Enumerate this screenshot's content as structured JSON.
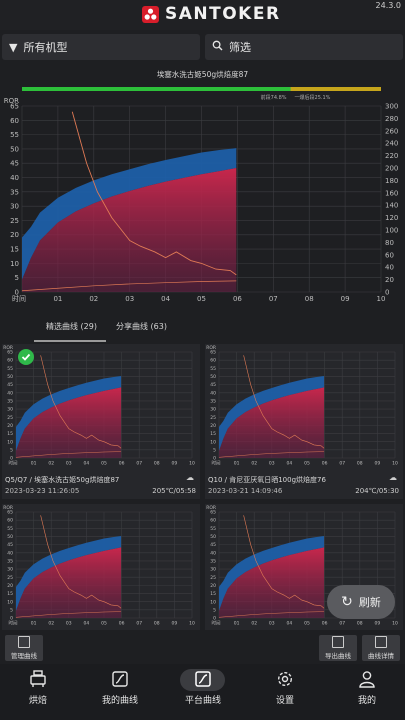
{
  "app": {
    "brand": "SANTOKER",
    "version": "24.3.0"
  },
  "filters": {
    "machine_label": "所有机型",
    "filter_label": "筛选"
  },
  "main_chart": {
    "title": "埃塞水洗古姬50g烘焙度87",
    "left_axis_label": "ROR",
    "x_axis_label": "时间",
    "progress_left_text": "前段74.8%",
    "progress_right_text": "一爆后段25.1%",
    "progress_fraction": 0.748,
    "colors": {
      "progress_green": "#2dbf3a",
      "progress_yellow": "#c6a51c",
      "fill_blue": "#1e5fa8",
      "fill_red": "#c8274c",
      "ror_line": "#e07a55"
    }
  },
  "tabs": {
    "selected": "精选曲线 (29)",
    "shared": "分享曲线 (63)"
  },
  "cards": [
    {
      "title": "Q5/Q7 / 埃塞水洗古姬50g烘焙度87",
      "date": "2023-03-23 11:26:05",
      "meta": "205℃/05:58",
      "selected": true
    },
    {
      "title": "Q10 / 肯尼亚厌氧日晒100g烘焙度76",
      "date": "2023-03-21 14:09:46",
      "meta": "204℃/05:30",
      "selected": false
    },
    {
      "title": "",
      "date": "",
      "meta": "",
      "selected": false
    },
    {
      "title": "",
      "date": "",
      "meta": "",
      "selected": false
    }
  ],
  "refresh_label": "刷新",
  "tools": {
    "manage": "管理曲线",
    "export": "导出曲线",
    "detail": "曲线详情"
  },
  "nav": {
    "roast": "烘焙",
    "my_curves": "我的曲线",
    "platform": "平台曲线",
    "settings": "设置",
    "mine": "我的"
  },
  "chart_data": {
    "type": "area",
    "title": "埃塞水洗古姬50g烘焙度87",
    "xlabel": "时间",
    "ylabel": "ROR",
    "x_ticks": [
      "01",
      "02",
      "03",
      "04",
      "05",
      "06",
      "07",
      "08",
      "09",
      "10"
    ],
    "y_left_ticks": [
      0,
      5,
      10,
      15,
      20,
      25,
      30,
      35,
      40,
      45,
      50,
      55,
      60,
      65
    ],
    "y_right_ticks": [
      0,
      20,
      40,
      60,
      80,
      100,
      120,
      140,
      160,
      180,
      200,
      220,
      240,
      260,
      280,
      300
    ],
    "xlim": [
      0,
      10
    ],
    "ylim_left": [
      0,
      65
    ],
    "ylim_right": [
      0,
      300
    ],
    "series": [
      {
        "axis": "right",
        "x": [
          0,
          0.25,
          0.5,
          1,
          1.5,
          2,
          2.5,
          3,
          3.5,
          4,
          4.5,
          5,
          5.5,
          5.97
        ],
        "values": [
          88,
          105,
          128,
          152,
          168,
          180,
          190,
          198,
          206,
          213,
          219,
          225,
          229,
          232
        ]
      },
      {
        "axis": "right",
        "x": [
          0,
          0.25,
          0.5,
          1,
          1.5,
          2,
          2.5,
          3,
          3.5,
          4,
          4.5,
          5,
          5.5,
          5.97
        ],
        "values": [
          20,
          55,
          83,
          112,
          130,
          143,
          154,
          163,
          171,
          178,
          184,
          190,
          195,
          200
        ]
      },
      {
        "axis": "left",
        "x": [
          1.4,
          1.8,
          2.1,
          2.5,
          3.0,
          3.3,
          3.7,
          4.0,
          4.3,
          4.7,
          5.0,
          5.4,
          5.8,
          5.97
        ],
        "values": [
          63,
          45,
          35,
          26,
          18,
          16,
          14,
          12,
          14,
          11,
          10,
          8,
          7.5,
          6
        ]
      },
      {
        "axis": "right",
        "x": [
          0,
          1,
          2,
          3,
          4,
          5,
          5.97
        ],
        "values": [
          2,
          6,
          10,
          13,
          15,
          17,
          18
        ]
      }
    ]
  }
}
